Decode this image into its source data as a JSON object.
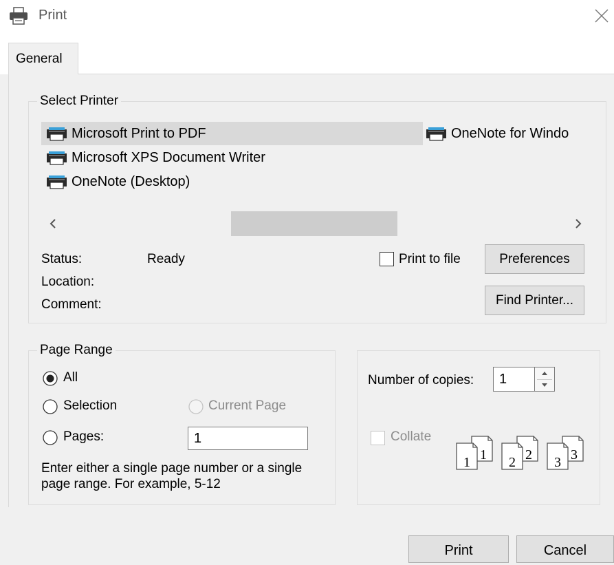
{
  "window": {
    "title": "Print",
    "close_symbol": "×"
  },
  "tabs": [
    {
      "label": "General",
      "selected": true
    }
  ],
  "select_printer": {
    "legend": "Select Printer",
    "printers": [
      {
        "name": "Microsoft Print to PDF",
        "selected": true,
        "icon": "printer-icon"
      },
      {
        "name": "Microsoft XPS Document Writer",
        "selected": false,
        "icon": "printer-icon"
      },
      {
        "name": "OneNote (Desktop)",
        "selected": false,
        "icon": "printer-icon"
      },
      {
        "name": "OneNote for Windo",
        "selected": false,
        "icon": "printer-icon"
      }
    ],
    "scroll_left": "‹",
    "scroll_right": "›",
    "status_label": "Status:",
    "status_value": "Ready",
    "location_label": "Location:",
    "location_value": "",
    "comment_label": "Comment:",
    "comment_value": "",
    "print_to_file_label": "Print to file",
    "print_to_file_checked": false,
    "preferences_label": "Preferences",
    "find_printer_label": "Find Printer..."
  },
  "page_range": {
    "legend": "Page Range",
    "all_label": "All",
    "selection_label": "Selection",
    "current_page_label": "Current Page",
    "pages_label": "Pages:",
    "pages_value": "1",
    "selected_option": "All",
    "help_line1": "Enter either a single page number or a single",
    "help_line2": "page range.  For example, 5-12"
  },
  "copies": {
    "label": "Number of copies:",
    "value": "1",
    "collate_label": "Collate",
    "collate_checked": false,
    "collate_enabled": false,
    "collate_pages": [
      "1",
      "1",
      "2",
      "2",
      "3",
      "3"
    ]
  },
  "footer": {
    "print_label": "Print",
    "cancel_label": "Cancel"
  },
  "colors": {
    "accent_selected_row": "#d9d9d9",
    "disabled_text": "#8c8c8c"
  }
}
